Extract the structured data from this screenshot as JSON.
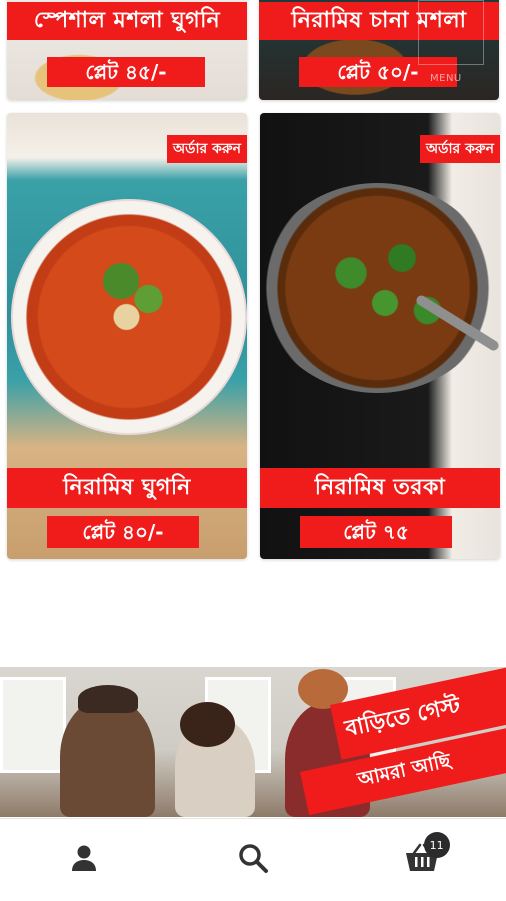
{
  "products": [
    {
      "title": "স্পেশাল মশলা ঘুগনি",
      "price": "প্লেট ৪৫/-"
    },
    {
      "title": "নিরামিষ চানা মশলা",
      "price": "প্লেট ৫০/-"
    },
    {
      "title": "নিরামিষ ঘুগনি",
      "price": "প্লেট ৪০/-",
      "order_label": "অর্ডার করুন"
    },
    {
      "title": "নিরামিষ তরকা",
      "price": "প্লেট ৭৫",
      "order_label": "অর্ডার করুন"
    }
  ],
  "menu_label": "MENU",
  "promo": {
    "line1": "বাড়িতে গেস্ট",
    "line2": "আমরা আছি"
  },
  "nav": {
    "cart_count": "11"
  },
  "colors": {
    "accent": "#f01b1b",
    "badge": "#2b2b2b"
  },
  "icons": [
    "user-icon",
    "search-icon",
    "cart-icon"
  ]
}
